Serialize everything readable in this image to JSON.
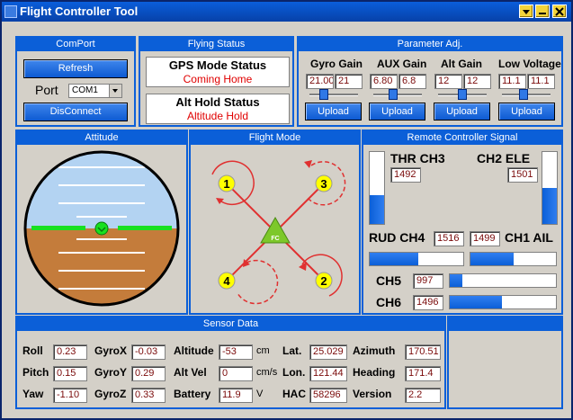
{
  "window": {
    "title": "Flight Controller Tool"
  },
  "comport": {
    "header": "ComPort",
    "refresh_label": "Refresh",
    "port_label": "Port",
    "port_value": "COM1",
    "disconnect_label": "DisConnect"
  },
  "flying_status": {
    "header": "Flying Status",
    "gps_title": "GPS Mode Status",
    "gps_value": "Coming Home",
    "alt_title": "Alt Hold Status",
    "alt_value": "Altitude Hold"
  },
  "params": {
    "header": "Parameter Adj.",
    "upload_label": "Upload",
    "groups": [
      {
        "label": "Gyro Gain",
        "v1": "21.00",
        "v2": "21"
      },
      {
        "label": "AUX Gain",
        "v1": "6.80",
        "v2": "6.8"
      },
      {
        "label": "Alt Gain",
        "v1": "12",
        "v2": "12"
      },
      {
        "label": "Low Voltage",
        "v1": "11.1",
        "v2": "11.1"
      }
    ]
  },
  "attitude": {
    "header": "Attitude",
    "roll_deg": 0,
    "pitch_deg": 0
  },
  "flight_mode": {
    "header": "Flight Mode",
    "center_label": "FC",
    "motors": [
      "1",
      "2",
      "3",
      "4"
    ],
    "colors": {
      "arm": "#e03030",
      "motor": "#ffff00",
      "center": "#7dc82a"
    }
  },
  "rc": {
    "header": "Remote Controller Signal",
    "thr_label": "THR CH3",
    "thr_value": "1492",
    "thr_fraction": 0.4,
    "ele_label": "CH2 ELE",
    "ele_value": "1501",
    "ele_fraction": 0.5,
    "rud_label": "RUD CH4",
    "rud_value": "1516",
    "ail_value": "1499",
    "ail_label": "CH1 AIL",
    "rud_fraction": 0.52,
    "ail_fraction": 0.5,
    "ch5_label": "CH5",
    "ch5_value": "997",
    "ch5_fraction": 0.12,
    "ch6_label": "CH6",
    "ch6_value": "1496",
    "ch6_fraction": 0.49
  },
  "sensor": {
    "header": "Sensor Data",
    "roll_label": "Roll",
    "roll": "0.23",
    "pitch_label": "Pitch",
    "pitch": "0.15",
    "yaw_label": "Yaw",
    "yaw": "-1.10",
    "gyrox_label": "GyroX",
    "gyrox": "-0.03",
    "gyroy_label": "GyroY",
    "gyroy": "0.29",
    "gyroz_label": "GyroZ",
    "gyroz": "0.33",
    "altitude_label": "Altitude",
    "altitude": "-53",
    "altitude_unit": "cm",
    "altvel_label": "Alt Vel",
    "altvel": "0",
    "altvel_unit": "cm/s",
    "battery_label": "Battery",
    "battery": "11.9",
    "battery_unit": "V",
    "lat_label": "Lat.",
    "lat": "25.029",
    "lon_label": "Lon.",
    "lon": "121.44",
    "hac_label": "HAC",
    "hac": "58296",
    "azimuth_label": "Azimuth",
    "azimuth": "170.51",
    "heading_label": "Heading",
    "heading": "171.4",
    "version_label": "Version",
    "version": "2.2"
  }
}
